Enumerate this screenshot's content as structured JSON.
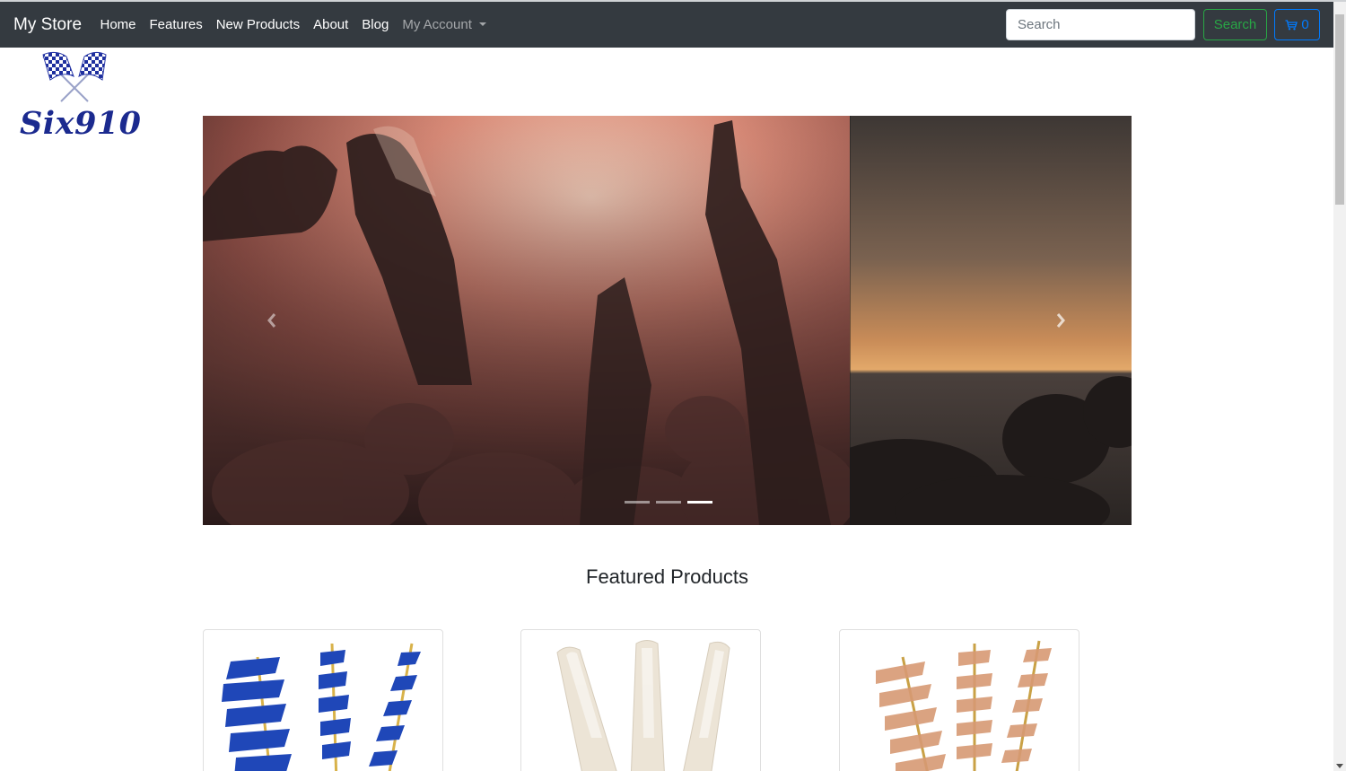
{
  "navbar": {
    "brand": "My Store",
    "links": [
      "Home",
      "Features",
      "New Products",
      "About",
      "Blog"
    ],
    "account_label": "My Account",
    "search_placeholder": "Search",
    "search_button": "Search",
    "cart_count": "0"
  },
  "logo": {
    "text": "Six910"
  },
  "carousel": {
    "slide_count": 3,
    "active_index": 2
  },
  "featured": {
    "title": "Featured Products"
  },
  "colors": {
    "navbar_bg": "#343a40",
    "success": "#28a745",
    "primary": "#007bff",
    "logo_blue": "#1b2a8f"
  },
  "icons": [
    "cart-icon",
    "checkered-flags-icon",
    "chevron-left-icon",
    "chevron-right-icon"
  ]
}
